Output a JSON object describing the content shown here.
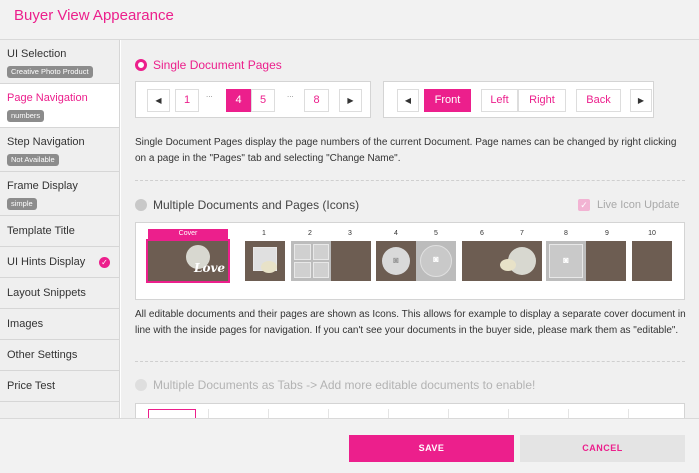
{
  "header": {
    "title": "Buyer View Appearance"
  },
  "sidebar": {
    "items": [
      {
        "label": "UI Selection",
        "badge": "Creative Photo Product"
      },
      {
        "label": "Page Navigation",
        "badge": "numbers"
      },
      {
        "label": "Step Navigation",
        "badge": "Not Available"
      },
      {
        "label": "Frame Display",
        "badge": "simple"
      },
      {
        "label": "Template Title"
      },
      {
        "label": "UI Hints Display"
      },
      {
        "label": "Layout Snippets"
      },
      {
        "label": "Images"
      },
      {
        "label": "Other Settings"
      },
      {
        "label": "Price Test"
      }
    ],
    "active_index": 1,
    "checked_index": 5
  },
  "options": {
    "single": {
      "label": "Single Document Pages",
      "selected": true,
      "pager_numbers": [
        "1",
        "4",
        "5",
        "8"
      ],
      "pager_ellipsis": "...",
      "active_page": "4",
      "sides": [
        "Front",
        "Left",
        "Right",
        "Back"
      ],
      "active_side": "Front",
      "description": "Single Document Pages display the page numbers of the current Document. Page names can be changed by right clicking on a page in the \"Pages\" tab and selecting \"Change Name\"."
    },
    "multiple": {
      "label": "Multiple Documents and Pages (Icons)",
      "selected": false,
      "live_update_label": "Live Icon Update",
      "live_update_checked": true,
      "cover_label": "Cover",
      "page_numbers": [
        "1",
        "2",
        "3",
        "4",
        "5",
        "6",
        "7",
        "8",
        "9",
        "10"
      ],
      "cover_text": "Love",
      "description": "All editable documents and their pages are shown as Icons. This allows for example to display a separate cover document in line with the inside pages for navigation. If you can't see your documents in the buyer side, please mark them as \"editable\"."
    },
    "tabs": {
      "label": "Multiple Documents as Tabs -> Add more editable documents to enable!",
      "enabled": false
    }
  },
  "footer": {
    "save_label": "SAVE",
    "cancel_label": "CANCEL"
  },
  "colors": {
    "accent": "#ec1f8c",
    "thumb_brown": "#6d5d52"
  }
}
